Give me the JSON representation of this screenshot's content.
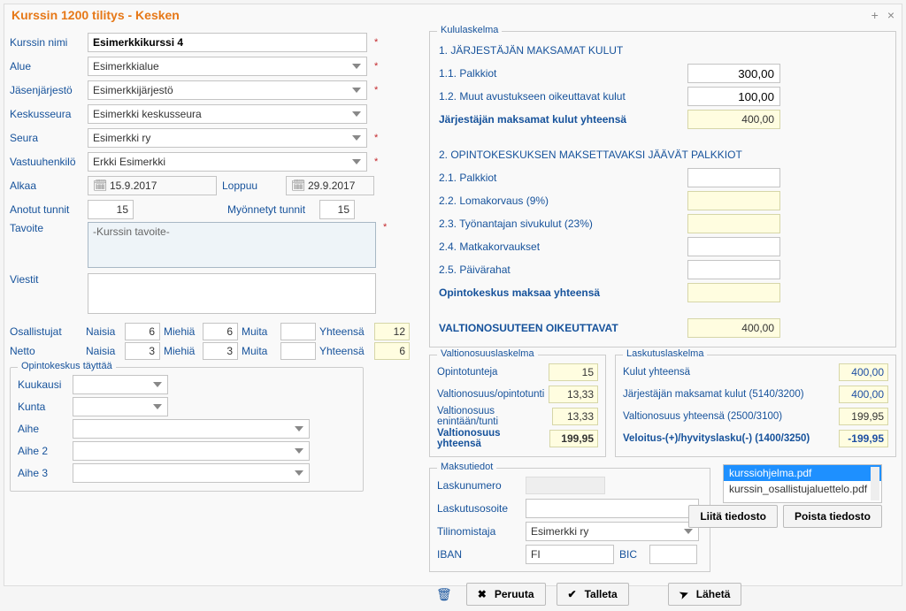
{
  "header": {
    "title": "Kurssin 1200 tilitys - Kesken"
  },
  "labels": {
    "kurssin_nimi": "Kurssin nimi",
    "alue": "Alue",
    "jasenjarjesto": "Jäsenjärjestö",
    "keskusseura": "Keskusseura",
    "seura": "Seura",
    "vastuuhenkilo": "Vastuuhenkilö",
    "alkaa": "Alkaa",
    "loppuu": "Loppuu",
    "anotut": "Anotut tunnit",
    "myonnetyt": "Myönnetyt tunnit",
    "tavoite": "Tavoite",
    "viestit": "Viestit",
    "osallistujat": "Osallistujat",
    "netto": "Netto",
    "naisia": "Naisia",
    "miehia": "Miehiä",
    "muita": "Muita",
    "yhteensa": "Yhteensä"
  },
  "form": {
    "kurssin_nimi": "Esimerkkikurssi 4",
    "alue": "Esimerkkialue",
    "jasenjarjesto": "Esimerkkijärjestö",
    "keskusseura": "Esimerkki keskusseura",
    "seura": "Esimerkki ry",
    "vastuuhenkilo": "Erkki Esimerkki",
    "alkaa": "15.9.2017",
    "loppuu": "29.9.2017",
    "anotut": "15",
    "myonnetyt": "15",
    "tavoite": "-Kurssin tavoite-",
    "viestit": ""
  },
  "participants": {
    "osallistujat": {
      "naisia": "6",
      "miehia": "6",
      "muita": "",
      "yhteensa": "12"
    },
    "netto": {
      "naisia": "3",
      "miehia": "3",
      "muita": "",
      "yhteensa": "6"
    }
  },
  "opinto": {
    "legend": "Opintokeskus täyttää",
    "kuukausi": "Kuukausi",
    "kunta": "Kunta",
    "aihe": "Aihe",
    "aihe2": "Aihe 2",
    "aihe3": "Aihe 3"
  },
  "kulu": {
    "legend": "Kululaskelma",
    "h1": "1. JÄRJESTÄJÄN MAKSAMAT KULUT",
    "l11": "1.1. Palkkiot",
    "v11": "300,00",
    "l12": "1.2. Muut avustukseen oikeuttavat kulut",
    "v12": "100,00",
    "lsum1": "Järjestäjän maksamat kulut yhteensä",
    "vsum1": "400,00",
    "h2": "2. OPINTOKESKUKSEN MAKSETTAVAKSI JÄÄVÄT PALKKIOT",
    "l21": "2.1. Palkkiot",
    "l22": "2.2. Lomakorvaus (9%)",
    "l23": "2.3. Työnantajan sivukulut (23%)",
    "l24": "2.4. Matkakorvaukset",
    "l25": "2.5. Päivärahat",
    "lsum2": "Opintokeskus maksaa yhteensä",
    "h3": "VALTIONOSUUTEEN OIKEUTTAVAT",
    "vsum3": "400,00"
  },
  "valtio": {
    "legend": "Valtionosuuslaskelma",
    "l1": "Opintotunteja",
    "v1": "15",
    "l2": "Valtionosuus/opintotunti",
    "v2": "13,33",
    "l3": "Valtionosuus enintään/tunti",
    "v3": "13,33",
    "l4": "Valtionosuus yhteensä",
    "v4": "199,95"
  },
  "lasku": {
    "legend": "Laskutuslaskelma",
    "l1": "Kulut yhteensä",
    "v1": "400,00",
    "l2": "Järjestäjän maksamat kulut (5140/3200)",
    "v2": "400,00",
    "l3": "Valtionosuus yhteensä (2500/3100)",
    "v3": "199,95",
    "l4": "Veloitus-(+)/hyvityslasku(-) (1400/3250)",
    "v4": "-199,95"
  },
  "maksu": {
    "legend": "Maksutiedot",
    "laskunumero_lbl": "Laskunumero",
    "laskunumero": "",
    "laskutusosoite_lbl": "Laskutusosoite",
    "laskutusosoite": "",
    "tilinomistaja_lbl": "Tilinomistaja",
    "tilinomistaja": "Esimerkki ry",
    "iban_lbl": "IBAN",
    "iban": "FI",
    "bic_lbl": "BIC",
    "bic": ""
  },
  "files": {
    "items": [
      "kurssiohjelma.pdf",
      "kurssin_osallistujaluettelo.pdf"
    ],
    "attach": "Liitä tiedosto",
    "remove": "Poista tiedosto"
  },
  "actions": {
    "peruuta": "Peruuta",
    "talleta": "Talleta",
    "laheta": "Lähetä"
  }
}
